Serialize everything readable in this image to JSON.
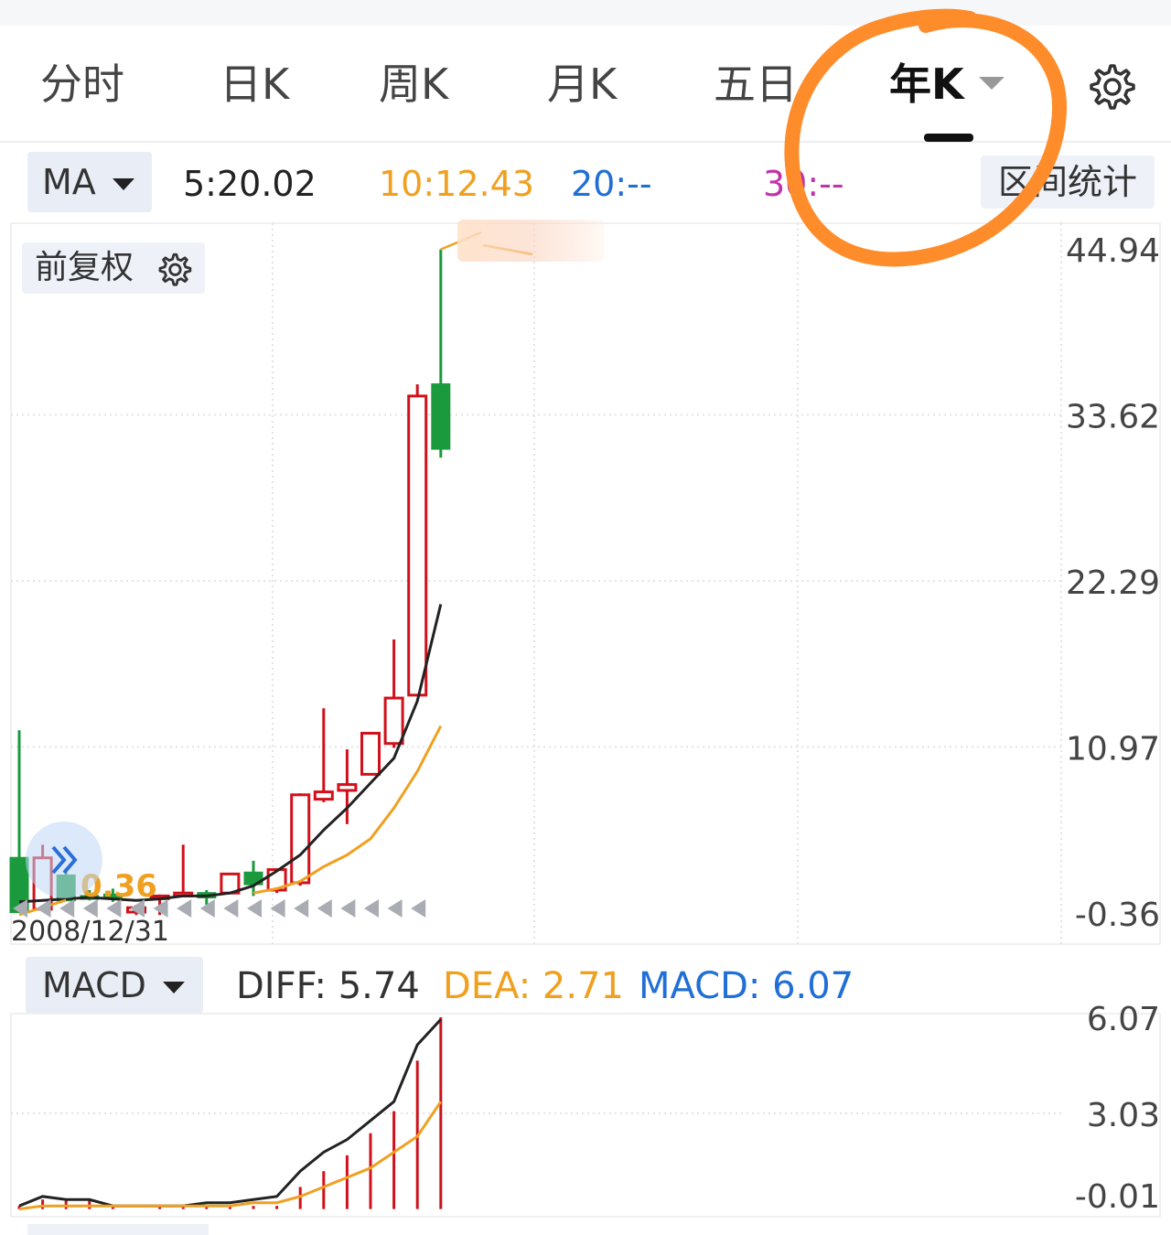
{
  "tabs": [
    {
      "label": "分时"
    },
    {
      "label": "日K"
    },
    {
      "label": "周K"
    },
    {
      "label": "月K"
    },
    {
      "label": "五日"
    },
    {
      "label": "年K",
      "active": true
    }
  ],
  "ma_bar": {
    "selector": "MA",
    "ma5": "5:20.02",
    "ma10": "10:12.43",
    "ma20": "20:--",
    "ma30": "30:--",
    "range_stats": "区间统计"
  },
  "adjust_label": "前复权",
  "macd_bar": {
    "selector": "MACD",
    "diff": "DIFF: 5.74",
    "dea": "DEA: 2.71",
    "macd": "MACD: 6.07"
  },
  "colors": {
    "up": "#d0111b",
    "down": "#1a9a3c",
    "ma5": "#222222",
    "ma10": "#f0a020",
    "ma20": "#1f6fd6",
    "ma30": "#c233a8",
    "annotation": "#ff8c2b"
  },
  "chart_data": {
    "type": "candlestick",
    "price_axis": {
      "ticks": [
        "44.94",
        "33.62",
        "22.29",
        "10.97",
        "-0.36"
      ],
      "range": [
        -0.36,
        44.94
      ]
    },
    "start_date": "2008/12/31",
    "min_label": "0.36",
    "candles": [
      {
        "open": 3.4,
        "high": 12.1,
        "low": -0.3,
        "close": -0.3
      },
      {
        "open": -0.1,
        "high": 4.3,
        "low": -0.2,
        "close": 3.4
      },
      {
        "open": 2.2,
        "high": 2.7,
        "low": 0.5,
        "close": 0.5
      },
      {
        "open": 0.8,
        "high": 1.2,
        "low": 0.5,
        "close": 0.6
      },
      {
        "open": 0.9,
        "high": 1.3,
        "low": 0.4,
        "close": 0.8
      },
      {
        "open": -0.3,
        "high": 0.2,
        "low": -0.5,
        "close": 0.0
      },
      {
        "open": 0.8,
        "high": 0.9,
        "low": -0.5,
        "close": 0.8
      },
      {
        "open": 0.8,
        "high": 4.3,
        "low": 0.8,
        "close": 1.0
      },
      {
        "open": 1.0,
        "high": 1.2,
        "low": 0.2,
        "close": 0.7
      },
      {
        "open": 1.0,
        "high": 2.0,
        "low": 1.0,
        "close": 2.3
      },
      {
        "open": 2.4,
        "high": 3.2,
        "low": 0.8,
        "close": 1.6
      },
      {
        "open": 1.2,
        "high": 1.6,
        "low": 1.0,
        "close": 2.6
      },
      {
        "open": 1.7,
        "high": 7.8,
        "low": 1.5,
        "close": 7.7
      },
      {
        "open": 7.4,
        "high": 13.6,
        "low": 7.2,
        "close": 7.9
      },
      {
        "open": 8.0,
        "high": 10.8,
        "low": 5.7,
        "close": 8.4
      },
      {
        "open": 9.1,
        "high": 11.3,
        "low": 9.1,
        "close": 11.9
      },
      {
        "open": 11.2,
        "high": 18.3,
        "low": 10.9,
        "close": 14.3
      },
      {
        "open": 14.5,
        "high": 35.7,
        "low": 14.5,
        "close": 34.9
      },
      {
        "open": 35.7,
        "high": 44.9,
        "low": 30.7,
        "close": 31.3
      }
    ],
    "ma5": [
      0.4,
      0.5,
      0.6,
      0.7,
      0.6,
      0.5,
      0.6,
      0.8,
      0.8,
      1.0,
      1.5,
      2.5,
      3.6,
      5.3,
      6.8,
      8.5,
      10.2,
      14.1,
      20.7
    ],
    "ma10_start_index": 10,
    "ma10": [
      1.0,
      1.3,
      1.8,
      2.8,
      3.6,
      4.7,
      6.8,
      9.3,
      12.4
    ],
    "macd_axis": {
      "ticks": [
        "6.07",
        "3.03",
        "-0.01"
      ],
      "range": [
        -0.01,
        6.07
      ]
    },
    "diff": [
      0.1,
      0.4,
      0.3,
      0.3,
      0.1,
      0.1,
      0.1,
      0.1,
      0.2,
      0.2,
      0.3,
      0.4,
      1.2,
      1.8,
      2.2,
      2.8,
      3.4,
      5.2,
      6.0
    ],
    "dea": [
      0.0,
      0.1,
      0.1,
      0.1,
      0.1,
      0.1,
      0.1,
      0.1,
      0.1,
      0.1,
      0.2,
      0.2,
      0.4,
      0.7,
      1.0,
      1.3,
      1.8,
      2.3,
      3.4
    ],
    "macd_hist": [
      0.1,
      0.3,
      0.3,
      0.3,
      0.1,
      0.0,
      0.1,
      0.1,
      0.1,
      0.1,
      0.1,
      0.1,
      0.7,
      1.2,
      1.7,
      2.4,
      3.1,
      4.7,
      6.07
    ]
  }
}
